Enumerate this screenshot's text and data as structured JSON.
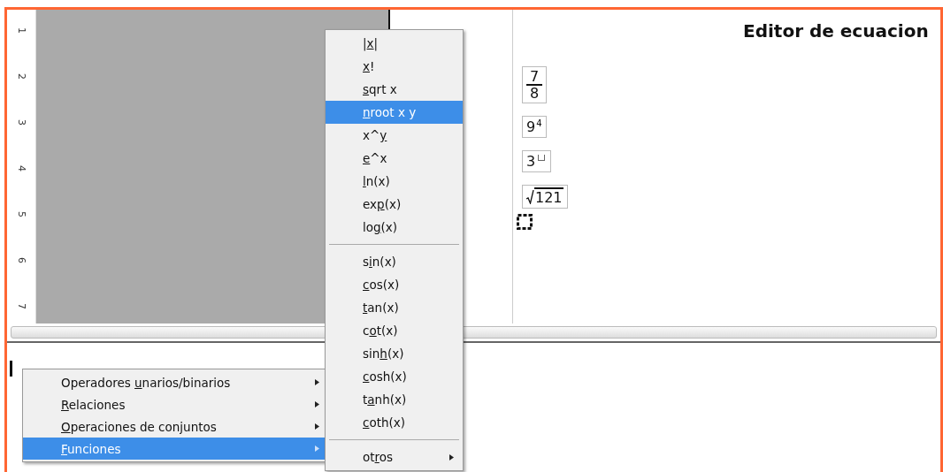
{
  "ruler": {
    "marks": [
      "1",
      "2",
      "3",
      "4",
      "5",
      "6",
      "7"
    ]
  },
  "document": {
    "title": "Editor de ecuacion",
    "formulas": [
      {
        "kind": "fraction",
        "numerator": "7",
        "denominator": "8"
      },
      {
        "kind": "power",
        "base": "9",
        "exponent": "4"
      },
      {
        "kind": "power_placeholder",
        "base": "3"
      },
      {
        "kind": "sqrt",
        "radicand": "121"
      },
      {
        "kind": "placeholder"
      }
    ]
  },
  "context_menu": {
    "items": [
      {
        "pre": "Operadores ",
        "key": "u",
        "post": "narios/binarios",
        "selected": false,
        "submenu": true
      },
      {
        "key": "R",
        "post": "elaciones",
        "selected": false,
        "submenu": true
      },
      {
        "key": "O",
        "post": "peraciones de conjuntos",
        "selected": false,
        "submenu": true
      },
      {
        "key": "F",
        "post": "unciones",
        "selected": true,
        "submenu": true
      }
    ]
  },
  "submenu": {
    "items": [
      {
        "kind": "item",
        "pre": "|",
        "key": "x",
        "post": "|",
        "selected": false
      },
      {
        "kind": "item",
        "key": "x",
        "post": "!",
        "selected": false
      },
      {
        "kind": "item",
        "key": "s",
        "post": "qrt x",
        "selected": false
      },
      {
        "kind": "item",
        "key": "n",
        "post": "root x y",
        "selected": true
      },
      {
        "kind": "item",
        "pre": "x^",
        "key": "y",
        "selected": false
      },
      {
        "kind": "item",
        "key": "e",
        "post": "^x",
        "selected": false
      },
      {
        "kind": "item",
        "key": "l",
        "post": "n(x)",
        "selected": false
      },
      {
        "kind": "item",
        "pre": "ex",
        "key": "p",
        "post": "(x)",
        "selected": false
      },
      {
        "kind": "item",
        "pre": "lo",
        "key": "g",
        "post": "(x)",
        "selected": false
      },
      {
        "kind": "separator"
      },
      {
        "kind": "item",
        "pre": "s",
        "key": "i",
        "post": "n(x)",
        "selected": false
      },
      {
        "kind": "item",
        "key": "c",
        "post": "os(x)",
        "selected": false
      },
      {
        "kind": "item",
        "key": "t",
        "post": "an(x)",
        "selected": false
      },
      {
        "kind": "item",
        "pre": "c",
        "key": "o",
        "post": "t(x)",
        "selected": false
      },
      {
        "kind": "item",
        "pre": "sin",
        "key": "h",
        "post": "(x)",
        "selected": false
      },
      {
        "kind": "item",
        "key": "c",
        "post": "osh(x)",
        "selected": false
      },
      {
        "kind": "item",
        "pre": "t",
        "key": "a",
        "post": "nh(x)",
        "selected": false
      },
      {
        "kind": "item",
        "key": "c",
        "post": "oth(x)",
        "selected": false
      },
      {
        "kind": "separator"
      },
      {
        "kind": "item",
        "pre": "ot",
        "key": "r",
        "post": "os",
        "selected": false,
        "submenu": true
      }
    ]
  }
}
